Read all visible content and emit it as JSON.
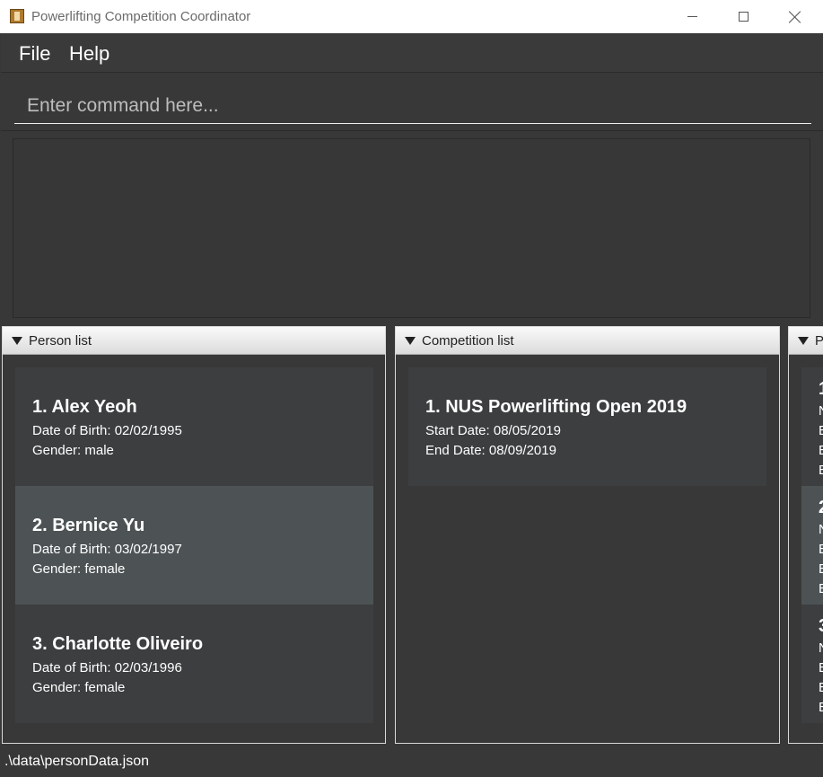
{
  "window": {
    "title": "Powerlifting Competition Coordinator",
    "icon": "app-icon"
  },
  "menu": {
    "items": [
      {
        "label": "File"
      },
      {
        "label": "Help"
      }
    ]
  },
  "command": {
    "placeholder": "Enter command here...",
    "value": ""
  },
  "result": {
    "text": ""
  },
  "panels": {
    "person_list": {
      "title": "Person list",
      "items": [
        {
          "title": "1.  Alex Yeoh",
          "dob": "Date of Birth: 02/02/1995",
          "gender": "Gender: male",
          "selected": false
        },
        {
          "title": "2.  Bernice Yu",
          "dob": "Date of Birth: 03/02/1997",
          "gender": "Gender: female",
          "selected": true
        },
        {
          "title": "3.  Charlotte Oliveiro",
          "dob": "Date of Birth: 02/03/1996",
          "gender": "Gender: female",
          "selected": false
        }
      ]
    },
    "competition_list": {
      "title": "Competition list",
      "items": [
        {
          "title": "1.  NUS Powerlifting Open 2019",
          "start": "Start Date: 08/05/2019",
          "end": "End Date: 08/09/2019"
        }
      ]
    },
    "third_panel": {
      "title_fragment": "P",
      "items": [
        {
          "line0": "1",
          "line1": "N",
          "line2": "E",
          "line3": "E",
          "line4": "E"
        },
        {
          "line0": "2",
          "line1": "N",
          "line2": "E",
          "line3": "E",
          "line4": "E"
        },
        {
          "line0": "3",
          "line1": "N",
          "line2": "E",
          "line3": "E",
          "line4": "E"
        }
      ]
    }
  },
  "status": {
    "path": ".\\data\\personData.json"
  },
  "colors": {
    "background": "#383838",
    "card": "#3c3e3f",
    "card_selected": "#4d5355",
    "text": "#ffffff"
  }
}
